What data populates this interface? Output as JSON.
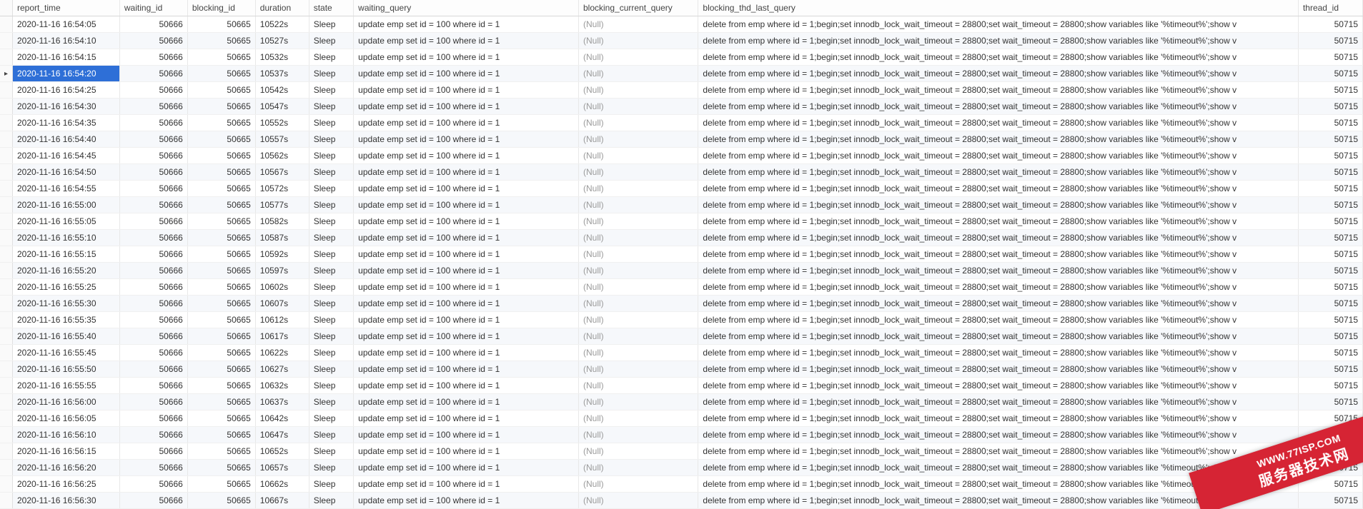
{
  "columns": [
    {
      "key": "report_time",
      "label": "report_time"
    },
    {
      "key": "waiting_id",
      "label": "waiting_id"
    },
    {
      "key": "blocking_id",
      "label": "blocking_id"
    },
    {
      "key": "duration",
      "label": "duration"
    },
    {
      "key": "state",
      "label": "state"
    },
    {
      "key": "waiting_query",
      "label": "waiting_query"
    },
    {
      "key": "blocking_current_query",
      "label": "blocking_current_query"
    },
    {
      "key": "blocking_thd_last_query",
      "label": "blocking_thd_last_query"
    },
    {
      "key": "thread_id",
      "label": "thread_id"
    }
  ],
  "common": {
    "waiting_id": "50666",
    "blocking_id": "50665",
    "state": "Sleep",
    "waiting_query": "update emp set id = 100 where id = 1",
    "blocking_current_query": "(Null)",
    "blocking_thd_last_query": "delete from emp where id = 1;begin;set innodb_lock_wait_timeout  = 28800;set wait_timeout  = 28800;show variables like '%timeout%';show v",
    "thread_id": "50715"
  },
  "selected_index": 3,
  "rows": [
    {
      "report_time": "2020-11-16 16:54:05",
      "duration": "10522s"
    },
    {
      "report_time": "2020-11-16 16:54:10",
      "duration": "10527s"
    },
    {
      "report_time": "2020-11-16 16:54:15",
      "duration": "10532s"
    },
    {
      "report_time": "2020-11-16 16:54:20",
      "duration": "10537s"
    },
    {
      "report_time": "2020-11-16 16:54:25",
      "duration": "10542s"
    },
    {
      "report_time": "2020-11-16 16:54:30",
      "duration": "10547s"
    },
    {
      "report_time": "2020-11-16 16:54:35",
      "duration": "10552s"
    },
    {
      "report_time": "2020-11-16 16:54:40",
      "duration": "10557s"
    },
    {
      "report_time": "2020-11-16 16:54:45",
      "duration": "10562s"
    },
    {
      "report_time": "2020-11-16 16:54:50",
      "duration": "10567s"
    },
    {
      "report_time": "2020-11-16 16:54:55",
      "duration": "10572s"
    },
    {
      "report_time": "2020-11-16 16:55:00",
      "duration": "10577s"
    },
    {
      "report_time": "2020-11-16 16:55:05",
      "duration": "10582s"
    },
    {
      "report_time": "2020-11-16 16:55:10",
      "duration": "10587s"
    },
    {
      "report_time": "2020-11-16 16:55:15",
      "duration": "10592s"
    },
    {
      "report_time": "2020-11-16 16:55:20",
      "duration": "10597s"
    },
    {
      "report_time": "2020-11-16 16:55:25",
      "duration": "10602s"
    },
    {
      "report_time": "2020-11-16 16:55:30",
      "duration": "10607s"
    },
    {
      "report_time": "2020-11-16 16:55:35",
      "duration": "10612s"
    },
    {
      "report_time": "2020-11-16 16:55:40",
      "duration": "10617s"
    },
    {
      "report_time": "2020-11-16 16:55:45",
      "duration": "10622s"
    },
    {
      "report_time": "2020-11-16 16:55:50",
      "duration": "10627s"
    },
    {
      "report_time": "2020-11-16 16:55:55",
      "duration": "10632s"
    },
    {
      "report_time": "2020-11-16 16:56:00",
      "duration": "10637s"
    },
    {
      "report_time": "2020-11-16 16:56:05",
      "duration": "10642s"
    },
    {
      "report_time": "2020-11-16 16:56:10",
      "duration": "10647s"
    },
    {
      "report_time": "2020-11-16 16:56:15",
      "duration": "10652s"
    },
    {
      "report_time": "2020-11-16 16:56:20",
      "duration": "10657s"
    },
    {
      "report_time": "2020-11-16 16:56:25",
      "duration": "10662s"
    },
    {
      "report_time": "2020-11-16 16:56:30",
      "duration": "10667s"
    }
  ],
  "watermark": {
    "url": "WWW.77ISP.COM",
    "title": "服务器技术网"
  }
}
